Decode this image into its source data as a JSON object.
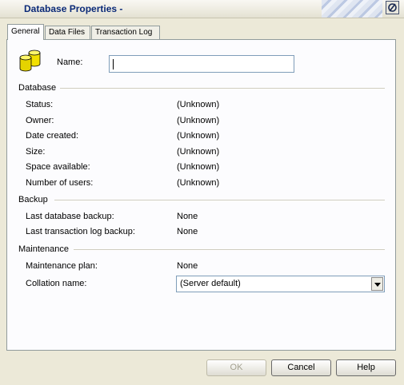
{
  "window": {
    "title": "Database Properties -"
  },
  "tabs": [
    {
      "label": "General",
      "active": true
    },
    {
      "label": "Data Files",
      "active": false
    },
    {
      "label": "Transaction Log",
      "active": false
    }
  ],
  "general": {
    "name_label": "Name:",
    "name_value": "",
    "database": {
      "header": "Database",
      "rows": [
        {
          "label": "Status:",
          "value": "(Unknown)"
        },
        {
          "label": "Owner:",
          "value": "(Unknown)"
        },
        {
          "label": "Date created:",
          "value": "(Unknown)"
        },
        {
          "label": "Size:",
          "value": "(Unknown)"
        },
        {
          "label": "Space available:",
          "value": "(Unknown)"
        },
        {
          "label": "Number of users:",
          "value": "(Unknown)"
        }
      ]
    },
    "backup": {
      "header": "Backup",
      "rows": [
        {
          "label": "Last database backup:",
          "value": "None"
        },
        {
          "label": "Last transaction log backup:",
          "value": "None"
        }
      ]
    },
    "maintenance": {
      "header": "Maintenance",
      "plan_label": "Maintenance plan:",
      "plan_value": "None",
      "collation_label": "Collation name:",
      "collation_value": "(Server default)"
    }
  },
  "buttons": {
    "ok": "OK",
    "cancel": "Cancel",
    "help": "Help"
  },
  "icons": {
    "window_icon": "database-icon",
    "close": "close-icon",
    "dropdown": "chevron-down-icon"
  },
  "colors": {
    "title_text": "#0b2a78",
    "icon_yellow": "#f2e000"
  }
}
